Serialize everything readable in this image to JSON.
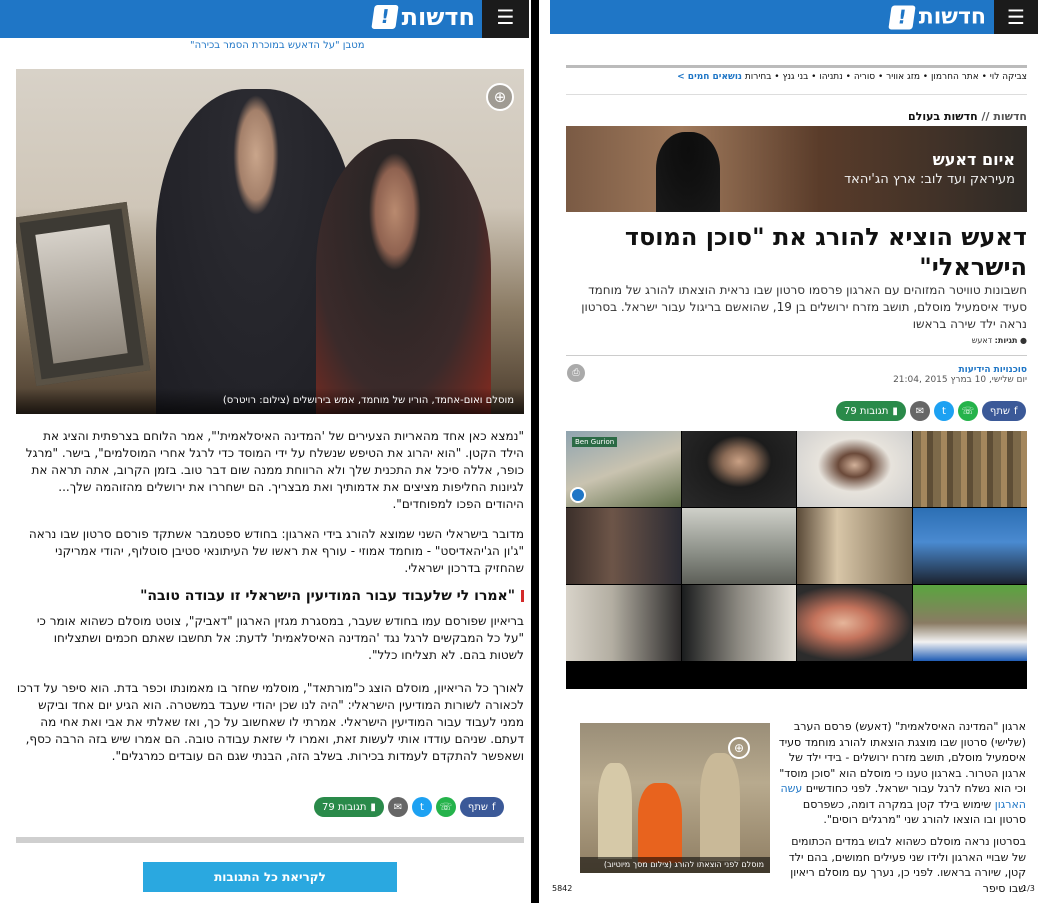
{
  "site": {
    "logo_text": "חדשות",
    "logo_mark": "!",
    "menu_icon": "☰",
    "brand_color": "#1f76c6"
  },
  "left": {
    "top_cutline": "מטבן \"על הדאעש במוכרת הסמר בכירה\"",
    "hero_caption": "מוסלם ואום-אחמד, הוריו של מוחמד, אמש בירושלים (צילום: רויטרס)",
    "p1": "\"נמצא כאן אחד מהאריות הצעירים של 'המדינה האיסלאמית'\", אמר הלוחם בצרפתית והציג את הילד הקטן. \"הוא יהרוג את הטיפש שנשלח על ידי המוסד כדי לרגל אחרי המוסלמים\", בישר. \"מרגל כופר, אללה סיכל את התכנית שלך ולא הרווחת ממנה שום דבר טוב. בזמן הקרוב, אתה תראה את לגיונות החליפות מציצים את אדמותיך ואת מבצריך. הם ישחררו את ירושלים מהזוהמה שלך... היהודים הפכו למפוחדים\".",
    "p2": "מדובר בישראלי השני שמוצא להורג בידי הארגון: בחודש ספטמבר אשתקד פורסם סרטון שבו נראה \"ג'ון הג'יהאדיסט\" - מוחמד אמוזי - עורף את ראשו של העיתונאי סטיבן סוטלוף, יהודי אמריקני שהחזיק בדרכון ישראלי.",
    "subhead": "\"אמרו לי שלעבוד עבור המודיעין הישראלי זו עבודה טובה\"",
    "p3": "בריאיון שפורסם עמו בחודש שעבר, במסגרת מגזין הארגון \"דאביק\", צוטט מוסלם כשהוא אומר כי \"על כל המבקשים לרגל נגד 'המדינה האיסלאמית' לדעת: אל תחשבו שאתם חכמים ושתצליחו לשטות בהם. לא תצליחו כלל\".",
    "p4": "לאורך כל הריאיון, מוסלם הוצג כ\"מורתאד\", מוסלמי שחזר בו מאמונתו וכפר בדת. הוא סיפר על דרכו לכאורה לשורות המודיעין הישראלי: \"היה לנו שכן יהודי שעבד במשטרה. הוא הגיע יום אחד וביקש ממני לעבוד עבור המודיעין הישראלי. אמרתי לו שאחשוב על כך, ואז שאלתי את אבי ואת אחי מה דעתם. שניהם עודדו אותי לעשות זאת, ואמרו לי שזאת עבודה טובה. הם אמרו שיש בזה הרבה כסף, ושאפשר להתקדם לעמדות בכירות. בשלב הזה, הבנתי שגם הם עובדים כמרגלים\".",
    "share_label": "שתף",
    "comments_label": "79 תגובות",
    "read_comments_button": "לקריאת כל התגובות"
  },
  "right": {
    "hot_topics": "נושאים חמים >",
    "tags": "צביקה לוי • אתר החרמון • מזג אוויר • סוריה • נתניהו • בני גנץ • בחירות",
    "crumb_root": "חדשות //",
    "crumb_current": "חדשות בעולם",
    "banner_title": "איום דאעש",
    "banner_subtitle": "מעיראק ועד לוב: ארץ הג'יהאד",
    "headline": "דאעש הוציא להורג את \"סוכן המוסד הישראלי\"",
    "dek": "חשבונות טוויטר המזוהים עם הארגון פרסמו סרטון שבו נראית הוצאתו להורג של מוחמד סעיד איסמעיל מוסלם, תושב מזרח ירושלים בן 19, שהואשם בריגול עבור ישראל. בסרטון נראה ילד שירה בראשו",
    "tags_label": "תגיות:",
    "tags_value": "דאעש",
    "agency": "סוכנויות הידיעות",
    "date": "יום שלישי, 10 במרץ 2015 ,21:04",
    "share_label": "שתף",
    "comments_label": "79 תגובות",
    "grid_sign_text": "Ben Gurion",
    "inline_caption": "מוסלם לפני הוצאתו להורג (צילום מסך מיוטיוב)",
    "body_p1_a": "ארגון \"המדינה האיסלאמית\" (דאעש) פרסם הערב (שלישי) סרטון שבו מוצגת הוצאתו להורג מוחמד סעיד איסמעיל מוסלם, תושב מזרח ירושלים - בידי ילד של ארגון הטרור. בארגון טענו כי מוסלם הוא \"סוכן מוסד\" וכי הוא נשלח לרגל עבור ישראל. לפני כחודשיים ",
    "body_p1_link": "עשה הארגון",
    "body_p1_b": " שימוש בילד קטן במקרה דומה, כשפרסם סרטון ובו הוצאו להורג שני \"מרגלים רוסים\".",
    "body_p2": "בסרטון נראה מוסלם כשהוא לבוש במדים הכתומים של שבויי הארגון ולידו שני פעילים חמושים, בהם ילד קטן, שיורה בראשו. לפני כן, נערך עם מוסלם ריאיון שבו סיפר",
    "page_left": "5842",
    "page_right": "1/3"
  }
}
